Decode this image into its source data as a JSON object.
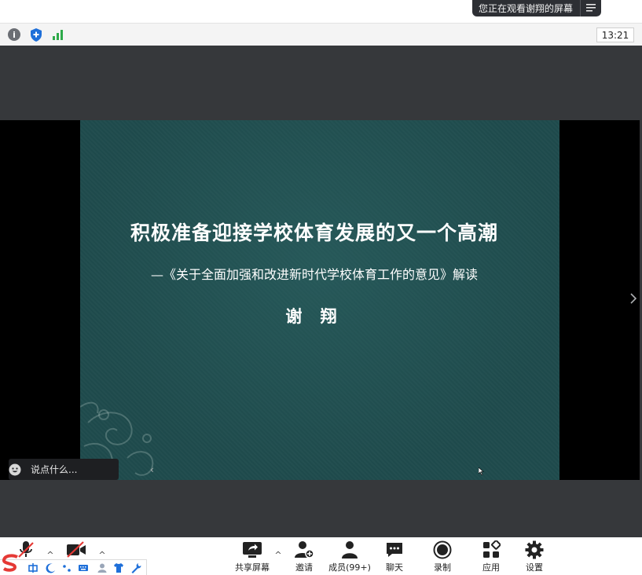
{
  "banner": {
    "viewing_text": "您正在观看谢翔的屏幕",
    "menu_icon": "list-menu-icon"
  },
  "status_bar": {
    "icons": [
      "info-icon",
      "shield-icon",
      "signal-icon"
    ],
    "time": "13:21"
  },
  "slide": {
    "title": "积极准备迎接学校体育发展的又一个高潮",
    "subtitle": "—《关于全面加强和改进新时代学校体育工作的意见》解读",
    "author": "谢  翔"
  },
  "chat": {
    "placeholder": "说点什么...",
    "collapse_glyph": "‹"
  },
  "toolbar": {
    "items": [
      {
        "label": "共享屏幕",
        "icon": "share-screen-icon"
      },
      {
        "label": "邀请",
        "icon": "invite-icon"
      },
      {
        "label": "成员(99+)",
        "icon": "members-icon"
      },
      {
        "label": "聊天",
        "icon": "chat-icon"
      },
      {
        "label": "录制",
        "icon": "record-icon"
      },
      {
        "label": "应用",
        "icon": "apps-icon"
      },
      {
        "label": "设置",
        "icon": "settings-icon"
      }
    ],
    "caret_glyph": "^"
  },
  "colors": {
    "slide_bg": "#1f4b4d",
    "meeting_bg": "#36383b",
    "banner_bg": "#2d2f34",
    "mute_red": "#e53935",
    "shield_blue": "#1e6fd9",
    "signal_green": "#2eaa4a"
  }
}
